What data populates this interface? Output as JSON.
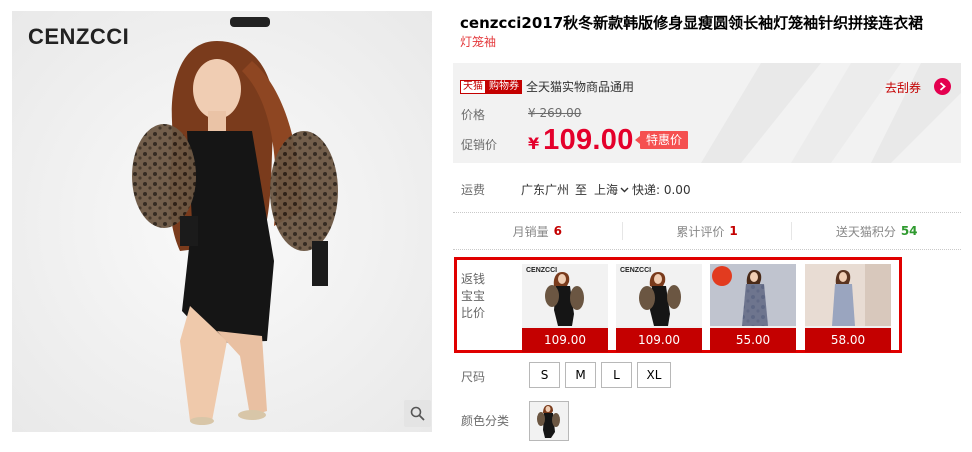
{
  "product": {
    "brand_logo": "CENZCCI",
    "title": "cenzcci2017秋冬新款韩版修身显瘦圆领长袖灯笼袖针织拼接连衣裙",
    "subtitle": "灯笼袖"
  },
  "coupon": {
    "tag_tmall": "天猫",
    "tag_coupon": "购物券",
    "text": "全天猫实物商品通用",
    "link": "去刮券"
  },
  "price": {
    "orig_label": "价格",
    "orig_value": "¥ 269.00",
    "promo_label": "促销价",
    "yen": "¥",
    "promo_value": "109.00",
    "badge": "特惠价"
  },
  "shipping": {
    "label": "运费",
    "from": "广东广州",
    "to_word": "至",
    "dest": "上海",
    "fee": "快递: 0.00"
  },
  "stats": [
    {
      "label": "月销量",
      "value": "6",
      "color": "#c40000"
    },
    {
      "label": "累计评价",
      "value": "1",
      "color": "#c40000"
    },
    {
      "label": "送天猫积分",
      "value": "54",
      "color": "#2f9a2f"
    }
  ],
  "compare": {
    "label": "返钱宝宝比价",
    "items": [
      {
        "price": "109.00",
        "logo": "CENZCCI"
      },
      {
        "price": "109.00",
        "logo": "CENZCCI"
      },
      {
        "price": "55.00",
        "logo": ""
      },
      {
        "price": "58.00",
        "logo": ""
      }
    ]
  },
  "sizes": {
    "label": "尺码",
    "options": [
      "S",
      "M",
      "L",
      "XL"
    ]
  },
  "colors": {
    "label": "颜色分类"
  },
  "theme": {
    "accent": "#c40000",
    "promo": "#e4002b",
    "compare_border": "#e00000"
  }
}
